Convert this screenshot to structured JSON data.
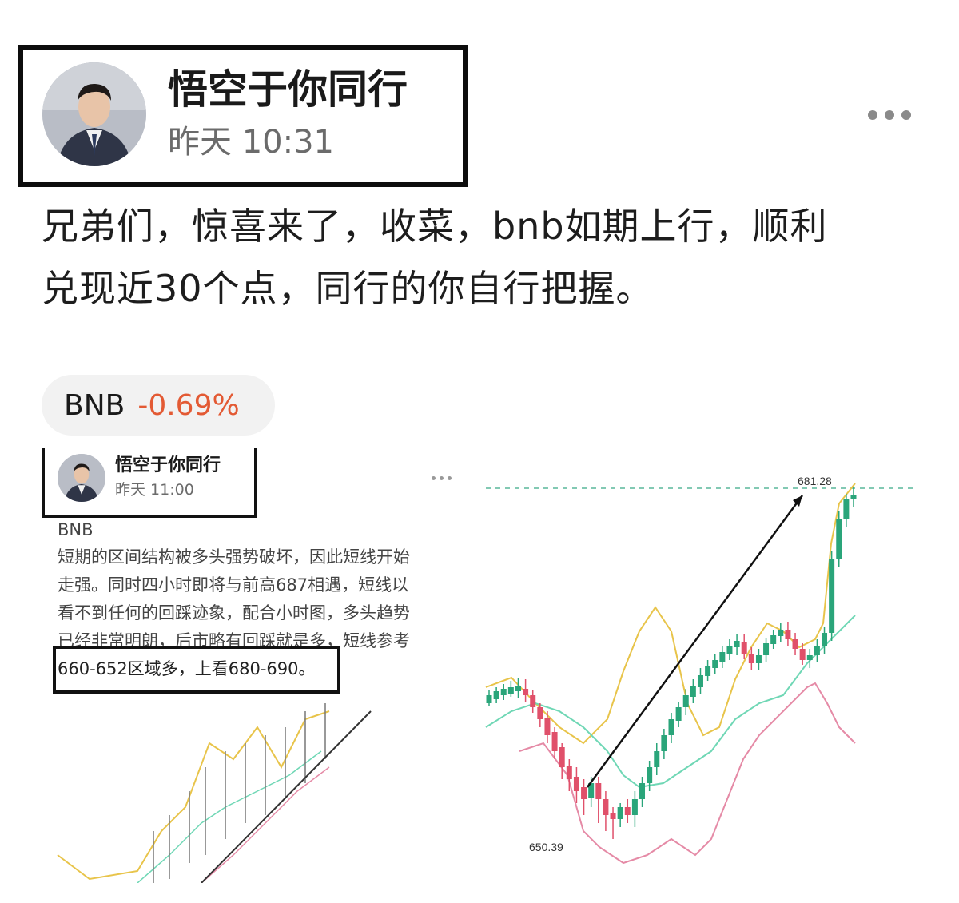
{
  "post": {
    "author": "悟空于你同行",
    "time": "昨天 10:31",
    "text_line1": "兄弟们，惊喜来了，收菜，bnb如期上行，顺利",
    "text_line2": "兑现近30个点，同行的你自行把握。"
  },
  "tag": {
    "symbol": "BNB",
    "change": "-0.69%",
    "change_color": "#e35a34"
  },
  "embedded_post": {
    "author": "悟空于你同行",
    "time": "昨天 11:00",
    "symbol": "BNB",
    "lines": [
      "短期的区间结构被多头强势破坏，因此短线开始",
      "走强。同时四小时即将与前高687相遇，短线以",
      "看不到任何的回踩迹象，配合小时图，多头趋势",
      "已经非常明朗，后市略有回踩就是多，短线参考",
      "660-652区域多，上看680-690。"
    ]
  },
  "chart_data": {
    "type": "candlestick",
    "high_label": "681.28",
    "low_label": "650.39",
    "annotations": [
      "681.28",
      "650.39"
    ],
    "colors": {
      "up": "#2aa57a",
      "down": "#e0506a",
      "upper_band": "#e8c44a",
      "middle_band": "#6fd7b5",
      "lower_band": "#e58aa6"
    }
  },
  "icons": {
    "more": "more-horizontal-icon",
    "avatar": "avatar-photo"
  }
}
